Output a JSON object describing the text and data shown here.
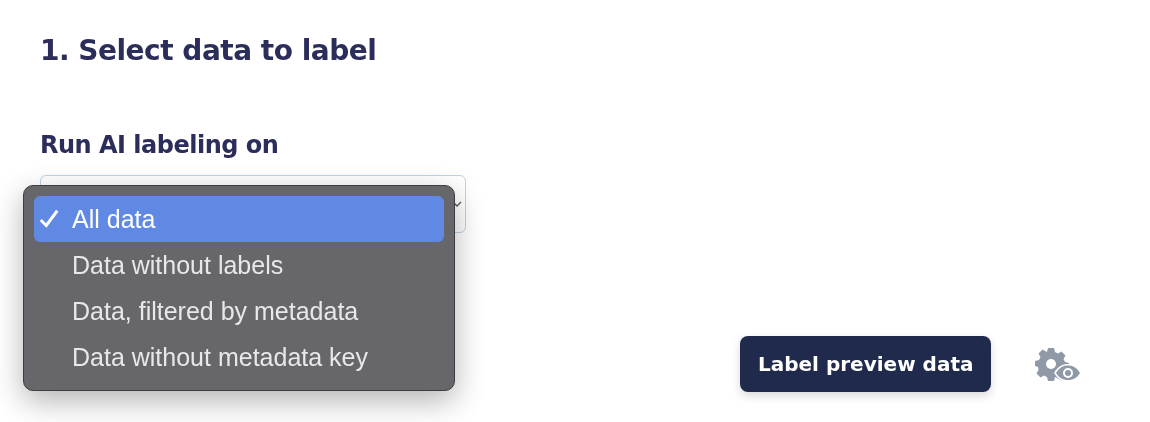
{
  "heading": "1. Select data to label",
  "field_label": "Run AI labeling on",
  "dropdown": {
    "options": [
      {
        "label": "All data",
        "selected": true
      },
      {
        "label": "Data without labels",
        "selected": false
      },
      {
        "label": "Data, filtered by metadata",
        "selected": false
      },
      {
        "label": "Data without metadata key",
        "selected": false
      }
    ]
  },
  "button": {
    "label": "Label preview data"
  }
}
